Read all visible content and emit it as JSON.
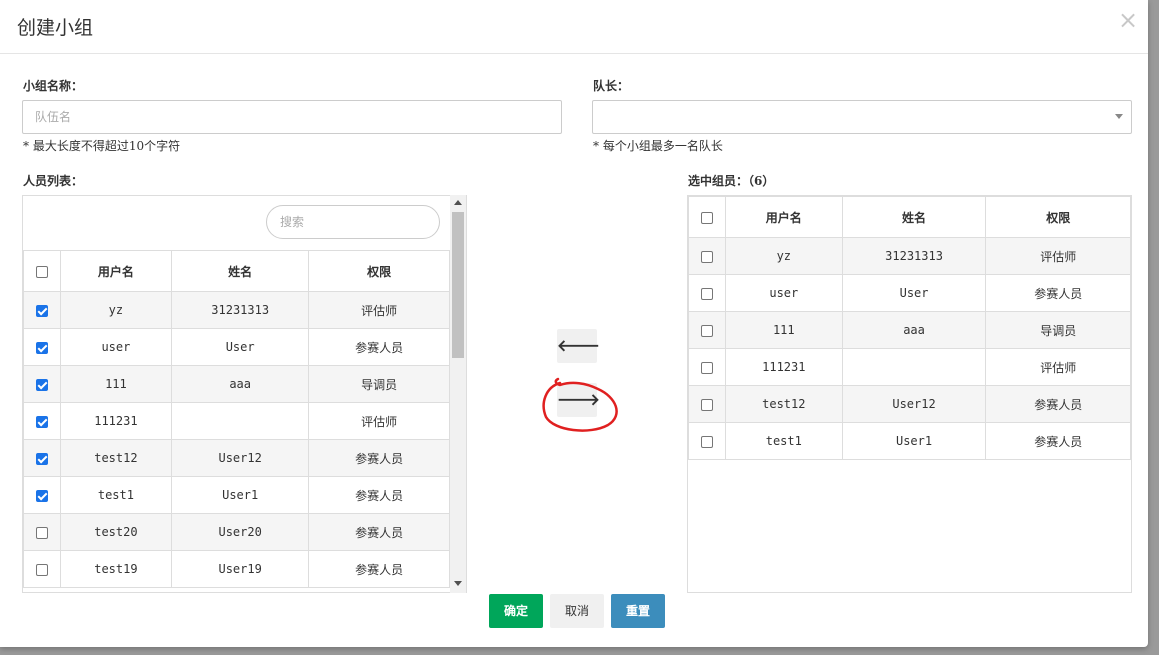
{
  "dialog": {
    "title": "创建小组",
    "close_glyph": "×"
  },
  "form": {
    "group_name_label": "小组名称：",
    "group_name_placeholder": "队伍名",
    "group_name_hint": "* 最大长度不得超过10个字符",
    "leader_label": "队长：",
    "leader_value": "",
    "leader_hint": "* 每个小组最多一名队长"
  },
  "people_list": {
    "label": "人员列表：",
    "search_placeholder": "搜索",
    "headers": [
      "用户名",
      "姓名",
      "权限"
    ],
    "rows": [
      {
        "checked": true,
        "username": "yz",
        "name": "31231313",
        "role": "评估师"
      },
      {
        "checked": true,
        "username": "user",
        "name": "User",
        "role": "参赛人员"
      },
      {
        "checked": true,
        "username": "111",
        "name": "aaa",
        "role": "导调员"
      },
      {
        "checked": true,
        "username": "111231",
        "name": "",
        "role": "评估师"
      },
      {
        "checked": true,
        "username": "test12",
        "name": "User12",
        "role": "参赛人员"
      },
      {
        "checked": true,
        "username": "test1",
        "name": "User1",
        "role": "参赛人员"
      },
      {
        "checked": false,
        "username": "test20",
        "name": "User20",
        "role": "参赛人员"
      },
      {
        "checked": false,
        "username": "test19",
        "name": "User19",
        "role": "参赛人员"
      }
    ]
  },
  "selected_members": {
    "label": "选中组员：（6）",
    "headers": [
      "用户名",
      "姓名",
      "权限"
    ],
    "rows": [
      {
        "checked": false,
        "username": "yz",
        "name": "31231313",
        "role": "评估师"
      },
      {
        "checked": false,
        "username": "user",
        "name": "User",
        "role": "参赛人员"
      },
      {
        "checked": false,
        "username": "111",
        "name": "aaa",
        "role": "导调员"
      },
      {
        "checked": false,
        "username": "111231",
        "name": "",
        "role": "评估师"
      },
      {
        "checked": false,
        "username": "test12",
        "name": "User12",
        "role": "参赛人员"
      },
      {
        "checked": false,
        "username": "test1",
        "name": "User1",
        "role": "参赛人员"
      }
    ]
  },
  "transfer": {
    "left_arrow": "🡐",
    "right_arrow": "🡒",
    "annotation_color": "#e02020"
  },
  "footer": {
    "ok_label": "确定",
    "cancel_label": "取消",
    "reset_label": "重置"
  },
  "colors": {
    "ok": "#00a65a",
    "reset": "#3c8dbc",
    "checkbox_on": "#1a73e8"
  }
}
